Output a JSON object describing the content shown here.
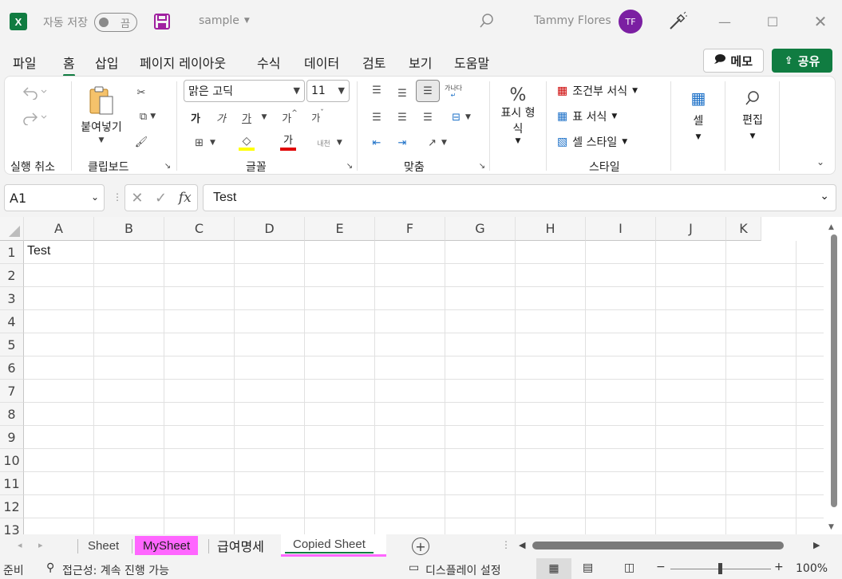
{
  "titlebar": {
    "logo": "X",
    "autosave_label": "자동 저장",
    "autosave_state": "끔",
    "filename": "sample",
    "user_name": "Tammy Flores",
    "user_initials": "TF",
    "avatar_color": "#7b1fa2",
    "icons": [
      "excel-icon",
      "save-icon",
      "search-icon",
      "magic-wand-icon",
      "minimize-icon",
      "maximize-icon",
      "close-icon"
    ]
  },
  "menu": {
    "items": [
      "파일",
      "홈",
      "삽입",
      "페이지 레이아웃",
      "수식",
      "데이터",
      "검토",
      "보기",
      "도움말"
    ],
    "active": "홈",
    "memo_label": "메모",
    "share_label": "공유"
  },
  "ribbon": {
    "undo_group": "실행 취소",
    "clipboard_group": "클립보드",
    "paste_label": "붙여넣기",
    "font_group": "글꼴",
    "font_name": "맑은 고딕",
    "font_size": "11",
    "bold": "가",
    "italic": "가",
    "underline": "가",
    "grow": "가",
    "shrink": "가",
    "font_color": "가",
    "phonetic": "내천",
    "align_group": "맞춤",
    "wrap": "가나다",
    "number_label": "표시 형식",
    "percent": "%",
    "styles_group": "스타일",
    "cond_format": "조건부 서식",
    "table_format": "표 서식",
    "cell_style": "셀 스타일",
    "cells_label": "셀",
    "edit_label": "편집"
  },
  "formula": {
    "namebox": "A1",
    "fx": "fx",
    "value": "Test"
  },
  "grid": {
    "columns": [
      "A",
      "B",
      "C",
      "D",
      "E",
      "F",
      "G",
      "H",
      "I",
      "J",
      "K"
    ],
    "rows": [
      "1",
      "2",
      "3",
      "4",
      "5",
      "6",
      "7",
      "8",
      "9",
      "10",
      "11",
      "12",
      "13"
    ],
    "a1_value": "Test"
  },
  "sheets": {
    "tabs": [
      {
        "name": "Sheet",
        "bg": "",
        "color": "#444"
      },
      {
        "name": "MySheet",
        "bg": "#ff66ff",
        "color": "#1f1f1f"
      },
      {
        "name": "급여명세",
        "bg": "",
        "color": "#1f1f1f"
      },
      {
        "name": "Copied Sheet",
        "bg": "#ffd6f5",
        "color": "#444"
      }
    ],
    "active": "Copied Sheet",
    "accent": "#107c41"
  },
  "status": {
    "ready": "준비",
    "accessibility": "접근성: 계속 진행 가능",
    "display_settings": "디스플레이 설정",
    "zoom": "100%"
  }
}
